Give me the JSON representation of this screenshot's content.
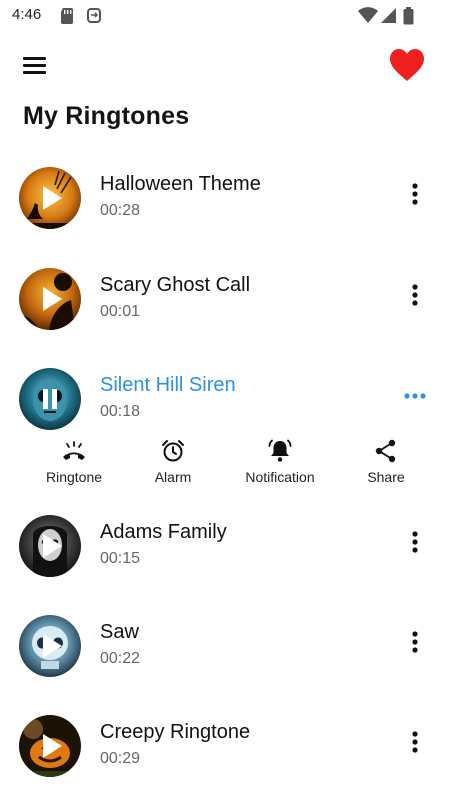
{
  "status_bar": {
    "time": "4:46",
    "icons": [
      "sd-card-icon",
      "sync-icon",
      "wifi-icon",
      "signal-icon",
      "battery-icon"
    ]
  },
  "app_bar": {
    "menu_icon": "hamburger-menu-icon",
    "favorite_icon": "heart-icon",
    "favorite_color": "#f02020"
  },
  "page": {
    "title": "My Ringtones"
  },
  "accent_color": "#2d8fe8",
  "ringtones": [
    {
      "title": "Halloween Theme",
      "duration": "00:28",
      "state": "stopped"
    },
    {
      "title": "Scary Ghost Call",
      "duration": "00:01",
      "state": "stopped"
    },
    {
      "title": "Silent Hill Siren",
      "duration": "00:18",
      "state": "playing"
    },
    {
      "title": "Adams Family",
      "duration": "00:15",
      "state": "stopped"
    },
    {
      "title": "Saw",
      "duration": "00:22",
      "state": "stopped"
    },
    {
      "title": "Creepy Ringtone",
      "duration": "00:29",
      "state": "stopped"
    }
  ],
  "actions": [
    {
      "label": "Ringtone",
      "icon": "phone-ringing-icon"
    },
    {
      "label": "Alarm",
      "icon": "alarm-clock-icon"
    },
    {
      "label": "Notification",
      "icon": "notification-bell-icon"
    },
    {
      "label": "Share",
      "icon": "share-icon"
    }
  ]
}
